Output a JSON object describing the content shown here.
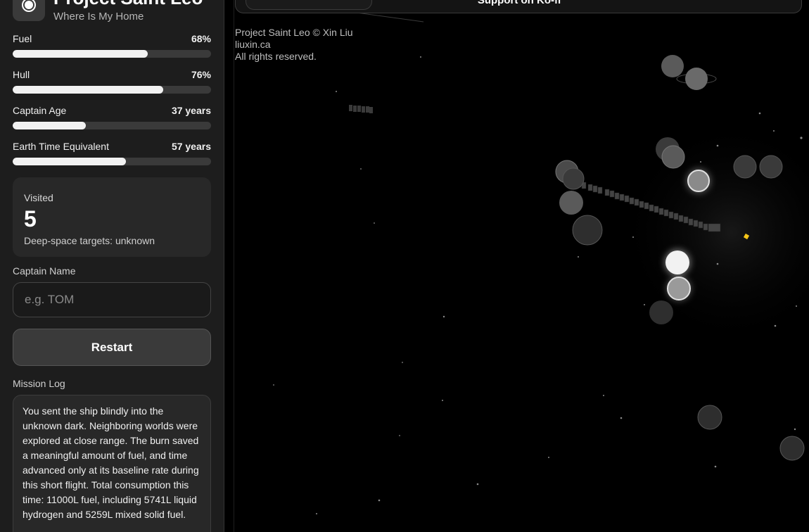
{
  "brand": {
    "title": "Project Saint Leo",
    "subtitle": "Where Is My Home"
  },
  "stats": [
    {
      "label": "Fuel",
      "value": "68%",
      "level": 0.68
    },
    {
      "label": "Hull",
      "value": "76%",
      "level": 0.76
    },
    {
      "label": "Captain Age",
      "value": "37 years",
      "level": 0.37
    },
    {
      "label": "Earth Time Equivalent",
      "value": "57 years",
      "level": 0.57
    }
  ],
  "visited": {
    "label": "Visited",
    "count": "5",
    "note": "Deep-space targets: unknown"
  },
  "captain": {
    "label": "Captain Name",
    "placeholder": "e.g. TOM"
  },
  "restart_label": "Restart",
  "log": {
    "label": "Mission Log",
    "text": "You sent the ship blindly into the unknown dark. Neighboring worlds were explored at close range. The burn saved a meaningful amount of fuel, and time advanced only at its baseline rate during this short flight. Total consumption this time: 11000L fuel, including 5741L liquid hydrogen and 5259L mixed solid fuel."
  },
  "top_bar": {
    "link": "Support on Ko-fi"
  },
  "credits": {
    "line1": "Project Saint Leo © Xin Liu",
    "line2": "liuxin.ca",
    "line3": "All rights reserved."
  },
  "colors": {
    "accent": "#f2f2f2",
    "ship": "#f5c518",
    "background": "#000000",
    "panel": "#1d1d1d"
  }
}
